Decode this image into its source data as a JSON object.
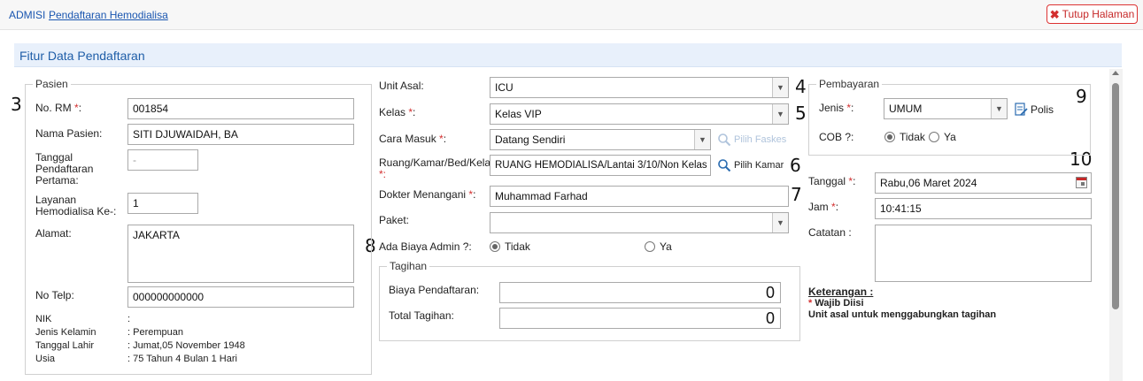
{
  "breadcrumb": {
    "root": "ADMISI",
    "current": "Pendaftaran Hemodialisa"
  },
  "close_button": "Tutup Halaman",
  "panel_title": "Fitur Data Pendaftaran",
  "markers": [
    "3",
    "4",
    "5",
    "6",
    "7",
    "8",
    "9",
    "10"
  ],
  "pasien": {
    "legend": "Pasien",
    "no_rm_label": "No. RM",
    "no_rm": "001854",
    "nama_label": "Nama Pasien:",
    "nama": "SITI DJUWAIDAH, BA",
    "tgl_pertama_label": [
      "Tanggal",
      "Pendaftaran",
      "Pertama:"
    ],
    "tgl_pertama": "-",
    "layanan_label": [
      "Layanan",
      "Hemodialisa Ke-:"
    ],
    "layanan": "1",
    "alamat_label": "Alamat:",
    "alamat": "JAKARTA",
    "telp_label": "No Telp:",
    "telp": "000000000000",
    "info": [
      {
        "label": "NIK",
        "value": ":"
      },
      {
        "label": "Jenis Kelamin",
        "value": ": Perempuan"
      },
      {
        "label": "Tanggal Lahir",
        "value": ": Jumat,05 November 1948"
      },
      {
        "label": "Usia",
        "value": ": 75 Tahun 4 Bulan 1 Hari"
      }
    ]
  },
  "mid": {
    "unit_label": "Unit Asal:",
    "unit": "ICU",
    "kelas_label": "Kelas",
    "kelas": "Kelas VIP",
    "cara_label": "Cara Masuk",
    "cara": "Datang Sendiri",
    "pilih_faskes": "Pilih Faskes",
    "ruang_label": "Ruang/Kamar/Bed/Kelas",
    "ruang": "RUANG HEMODIALISA/Lantai 3/10/Non Kelas",
    "pilih_kamar": "Pilih Kamar",
    "dokter_label": "Dokter Menangani",
    "dokter": "Muhammad Farhad",
    "paket_label": "Paket:",
    "paket": "",
    "admin_label": "Ada Biaya Admin ?:",
    "opt_tidak": "Tidak",
    "opt_ya": "Ya",
    "tagihan": {
      "legend": "Tagihan",
      "biaya_label": "Biaya Pendaftaran:",
      "biaya": "0",
      "total_label": "Total Tagihan:",
      "total": "0"
    }
  },
  "right": {
    "pembayaran": {
      "legend": "Pembayaran",
      "jenis_label": "Jenis",
      "jenis": "UMUM",
      "polis": "Polis",
      "cob_label": "COB ?:",
      "opt_tidak": "Tidak",
      "opt_ya": "Ya"
    },
    "tanggal_label": "Tanggal",
    "tanggal": "Rabu,06 Maret 2024",
    "jam_label": "Jam",
    "jam": "10:41:15",
    "catatan_label": "Catatan :",
    "catatan": "",
    "keterangan_label": "Keterangan :",
    "wajib": "Wajib Diisi",
    "note": "Unit asal untuk menggabungkan tagihan"
  },
  "colors": {
    "link": "#1a56b0",
    "required": "#d32f2f",
    "panel_header": "#e8f0fb"
  }
}
